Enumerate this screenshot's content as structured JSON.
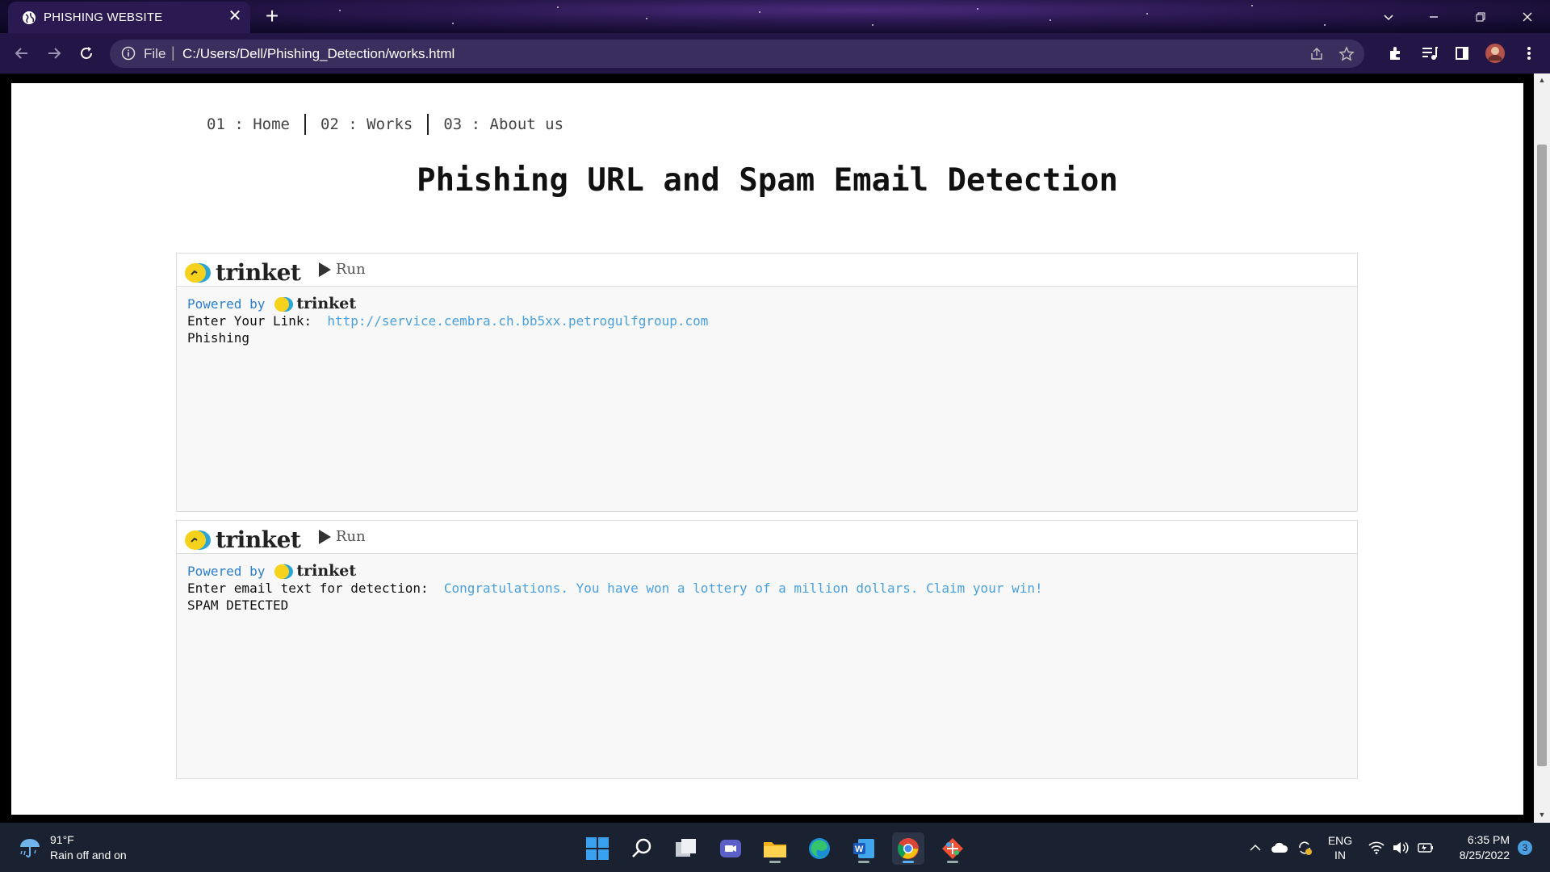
{
  "browser": {
    "tab_title": "PHISHING WEBSITE",
    "tab_close": "✕",
    "new_tab": "+",
    "address": {
      "scheme_label": "File",
      "separator": "|",
      "url": "C:/Users/Dell/Phishing_Detection/works.html"
    }
  },
  "page": {
    "nav": [
      {
        "label": "01 : Home"
      },
      {
        "label": "02 : Works"
      },
      {
        "label": "03 : About us"
      }
    ],
    "heading": "Phishing URL and Spam Email Detection",
    "trinkets": [
      {
        "brand": "trinket",
        "run_label": "Run",
        "powered_by": "Powered by",
        "prompt": "Enter Your Link:",
        "input_value": "http://service.cembra.ch.bb5xx.petrogulfgroup.com",
        "output": "Phishing"
      },
      {
        "brand": "trinket",
        "run_label": "Run",
        "powered_by": "Powered by",
        "prompt": "Enter email text for detection:",
        "input_value": "Congratulations. You have won a lottery of a million dollars. Claim your win!",
        "output": "SPAM DETECTED"
      }
    ]
  },
  "taskbar": {
    "weather": {
      "temp": "91°F",
      "desc": "Rain off and on"
    },
    "lang": {
      "line1": "ENG",
      "line2": "IN"
    },
    "clock": {
      "time": "6:35 PM",
      "date": "8/25/2022"
    },
    "notifications": "3"
  },
  "colors": {
    "accent_link": "#4aa0e0",
    "powered_blue": "#2a7fd4",
    "taskbar_bg": "#1a2130"
  }
}
